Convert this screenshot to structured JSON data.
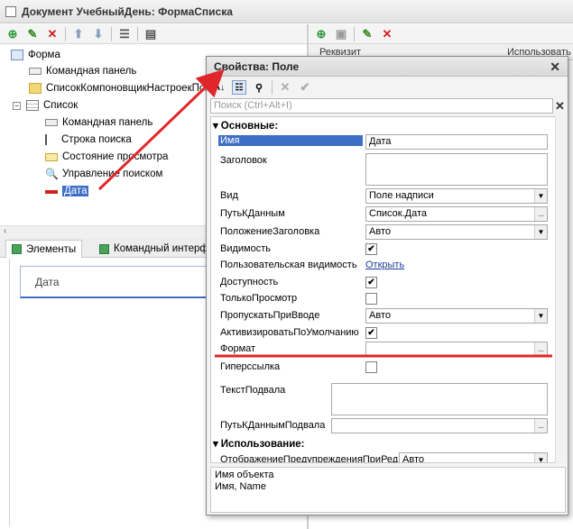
{
  "window": {
    "title": "Документ УчебныйДень: ФормаСписка"
  },
  "right_panel": {
    "col_requisite": "Реквизит",
    "col_use": "Использовать"
  },
  "tree": {
    "items": [
      {
        "label": "Форма"
      },
      {
        "label": "Командная панель"
      },
      {
        "label": "СписокКомпоновщикНастроекПол"
      },
      {
        "label": "Список"
      },
      {
        "label": "Командная панель"
      },
      {
        "label": "Строка поиска"
      },
      {
        "label": "Состояние просмотра"
      },
      {
        "label": "Управление поиском"
      },
      {
        "label": "Дата"
      }
    ]
  },
  "tabs": [
    {
      "label": "Элементы"
    },
    {
      "label": "Командный интерф"
    }
  ],
  "preview": {
    "field_label": "Дата"
  },
  "dialog": {
    "title": "Свойства: Поле",
    "search_placeholder": "Поиск (Ctrl+Alt+I)",
    "group_main": "Основные:",
    "group_use": "Использование:",
    "props": {
      "name_label": "Имя",
      "name_value": "Дата",
      "caption_label": "Заголовок",
      "view_label": "Вид",
      "view_value": "Поле надписи",
      "datapath_label": "ПутьКДанным",
      "datapath_value": "Список.Дата",
      "titlepos_label": "ПоложениеЗаголовка",
      "titlepos_value": "Авто",
      "visible_label": "Видимость",
      "uservis_label": "Пользовательская видимость",
      "uservis_link": "Открыть",
      "enabled_label": "Доступность",
      "readonly_label": "ТолькоПросмотр",
      "skip_label": "ПропускатьПриВводе",
      "skip_value": "Авто",
      "activate_label": "АктивизироватьПоУмолчанию",
      "format_label": "Формат",
      "hyperlink_label": "Гиперссылка",
      "footer_label": "ТекстПодвала",
      "footerpath_label": "ПутьКДаннымПодвала",
      "warn_label": "ОтображениеПредупрежденияПриРед",
      "warn_value": "Авто"
    },
    "description": {
      "line1": "Имя объекта",
      "line2": "Имя, Name"
    }
  },
  "icons": {
    "check": "✔",
    "close": "✕",
    "dots": "...",
    "dropdown": "▼"
  },
  "colors": {
    "selection": "#3d6ec6",
    "arrow": "#e0262b",
    "underline": "#e0262b"
  }
}
